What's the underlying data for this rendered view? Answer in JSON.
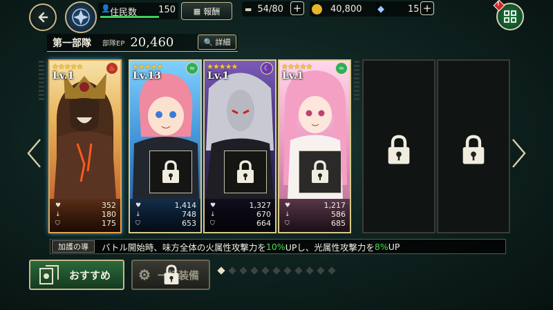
{
  "top_bar": {
    "back_icon": "back-arrow-icon",
    "avatar_icon": "emblem-icon",
    "residents_label": "住民数",
    "residents_value": "150",
    "reward_label": "報酬",
    "capacity_value": "54/80",
    "gold_value": "40,800",
    "crystal_value": "15",
    "menu_icon": "grid-menu-icon",
    "alert_badge": "!"
  },
  "party": {
    "name": "第一部隊",
    "ep_label": "部隊EP",
    "ep_value": "20,460",
    "detail_label": "詳細"
  },
  "cards": [
    {
      "level": "Lv.1",
      "stars": "★★★★★",
      "element": "fire",
      "hp": "352",
      "atk": "180",
      "def": "175",
      "locked": false
    },
    {
      "level": "Lv.13",
      "stars": "★★★★★",
      "element": "wind",
      "hp": "1,414",
      "atk": "748",
      "def": "653",
      "locked": true
    },
    {
      "level": "Lv.1",
      "stars": "★★★★★",
      "element": "dark",
      "hp": "1,327",
      "atk": "670",
      "def": "664",
      "locked": true
    },
    {
      "level": "Lv.1",
      "stars": "★★★★★",
      "element": "wind",
      "hp": "1,217",
      "atk": "586",
      "def": "685",
      "locked": true
    }
  ],
  "protection": {
    "label": "加護の導",
    "text_1": "バトル開始時、味方全体の火属性攻撃力を",
    "value_1": "10%",
    "text_2": "UPし、光属性攻撃力を",
    "value_2": "8%",
    "text_3": "UP"
  },
  "buttons": {
    "recommend": "おすすめ",
    "equip": "一括装備"
  },
  "pagination": {
    "total": 11,
    "current": 1
  },
  "colors": {
    "accent_gold": "#c9b98a",
    "highlight_green": "#4be04b",
    "fire": "#d9482a",
    "wind": "#2fae5a",
    "dark": "#6a3aa8"
  }
}
